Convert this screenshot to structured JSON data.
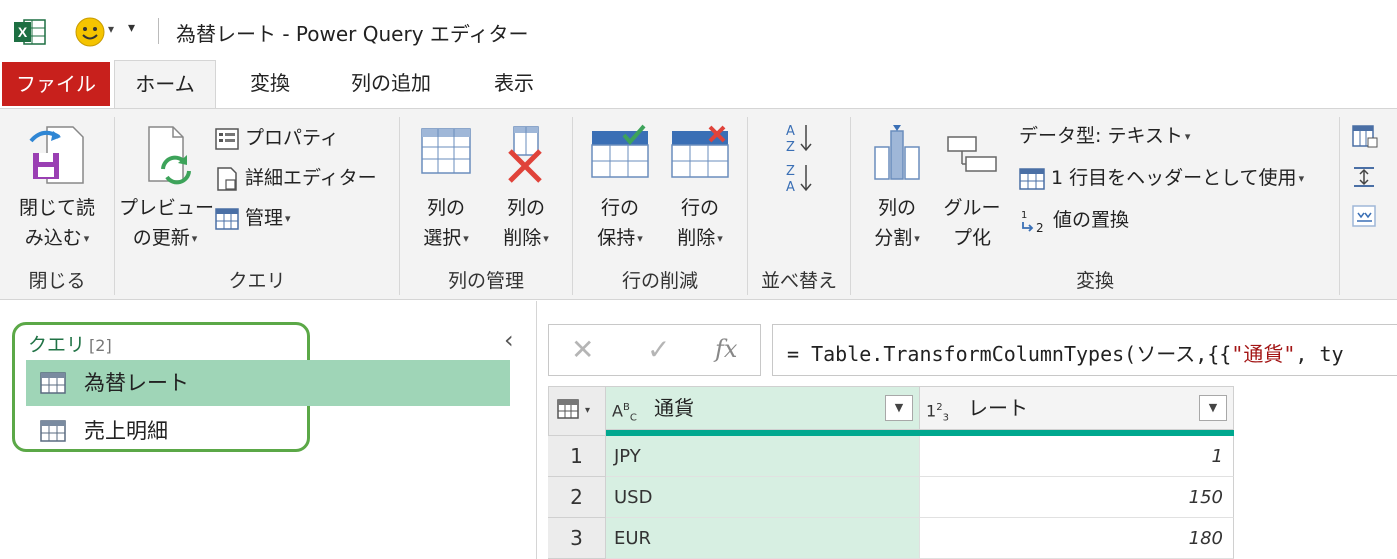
{
  "window": {
    "title": "為替レート - Power Query エディター"
  },
  "ribbon_tabs": [
    {
      "label": "ファイル"
    },
    {
      "label": "ホーム"
    },
    {
      "label": "変換"
    },
    {
      "label": "列の追加"
    },
    {
      "label": "表示"
    }
  ],
  "ribbon": {
    "close_group": {
      "label": "閉じる",
      "close_load": [
        "閉じて読",
        "み込む"
      ]
    },
    "query_group": {
      "label": "クエリ",
      "refresh_preview": [
        "プレビュー",
        "の更新"
      ],
      "properties": "プロパティ",
      "advanced_editor": "詳細エディター",
      "manage": "管理"
    },
    "manage_columns_group": {
      "label": "列の管理",
      "choose_columns": [
        "列の",
        "選択"
      ],
      "remove_columns": [
        "列の",
        "削除"
      ]
    },
    "reduce_rows_group": {
      "label": "行の削減",
      "keep_rows": [
        "行の",
        "保持"
      ],
      "remove_rows": [
        "行の",
        "削除"
      ]
    },
    "sort_group": {
      "label": "並べ替え"
    },
    "transform_group": {
      "label": "変換",
      "split_column": [
        "列の",
        "分割"
      ],
      "group_by": [
        "グルー",
        "プ化"
      ],
      "data_type": "データ型: テキスト",
      "use_first_row": "1 行目をヘッダーとして使用",
      "replace_values": "値の置換"
    }
  },
  "queries_pane": {
    "header": "クエリ",
    "count": "[2]",
    "items": [
      {
        "label": "為替レート",
        "selected": true
      },
      {
        "label": "売上明細",
        "selected": false
      }
    ]
  },
  "formula_bar": {
    "prefix": "= Table.TransformColumnTypes(ソース,{{",
    "string_part": "\"通貨\"",
    "suffix": ", ty"
  },
  "grid": {
    "columns": [
      {
        "name": "通貨",
        "type_icon": "ABC"
      },
      {
        "name": "レート",
        "type_icon": "123"
      }
    ],
    "rows": [
      {
        "num": "1",
        "currency": "JPY",
        "rate": "1"
      },
      {
        "num": "2",
        "currency": "USD",
        "rate": "150"
      },
      {
        "num": "3",
        "currency": "EUR",
        "rate": "180"
      }
    ]
  },
  "colors": {
    "file_tab": "#c8201c",
    "selected_query": "#9fd5b7",
    "highlight_box": "#5ba847",
    "column_underline": "#00a88f",
    "selected_column": "#d7efe2"
  }
}
